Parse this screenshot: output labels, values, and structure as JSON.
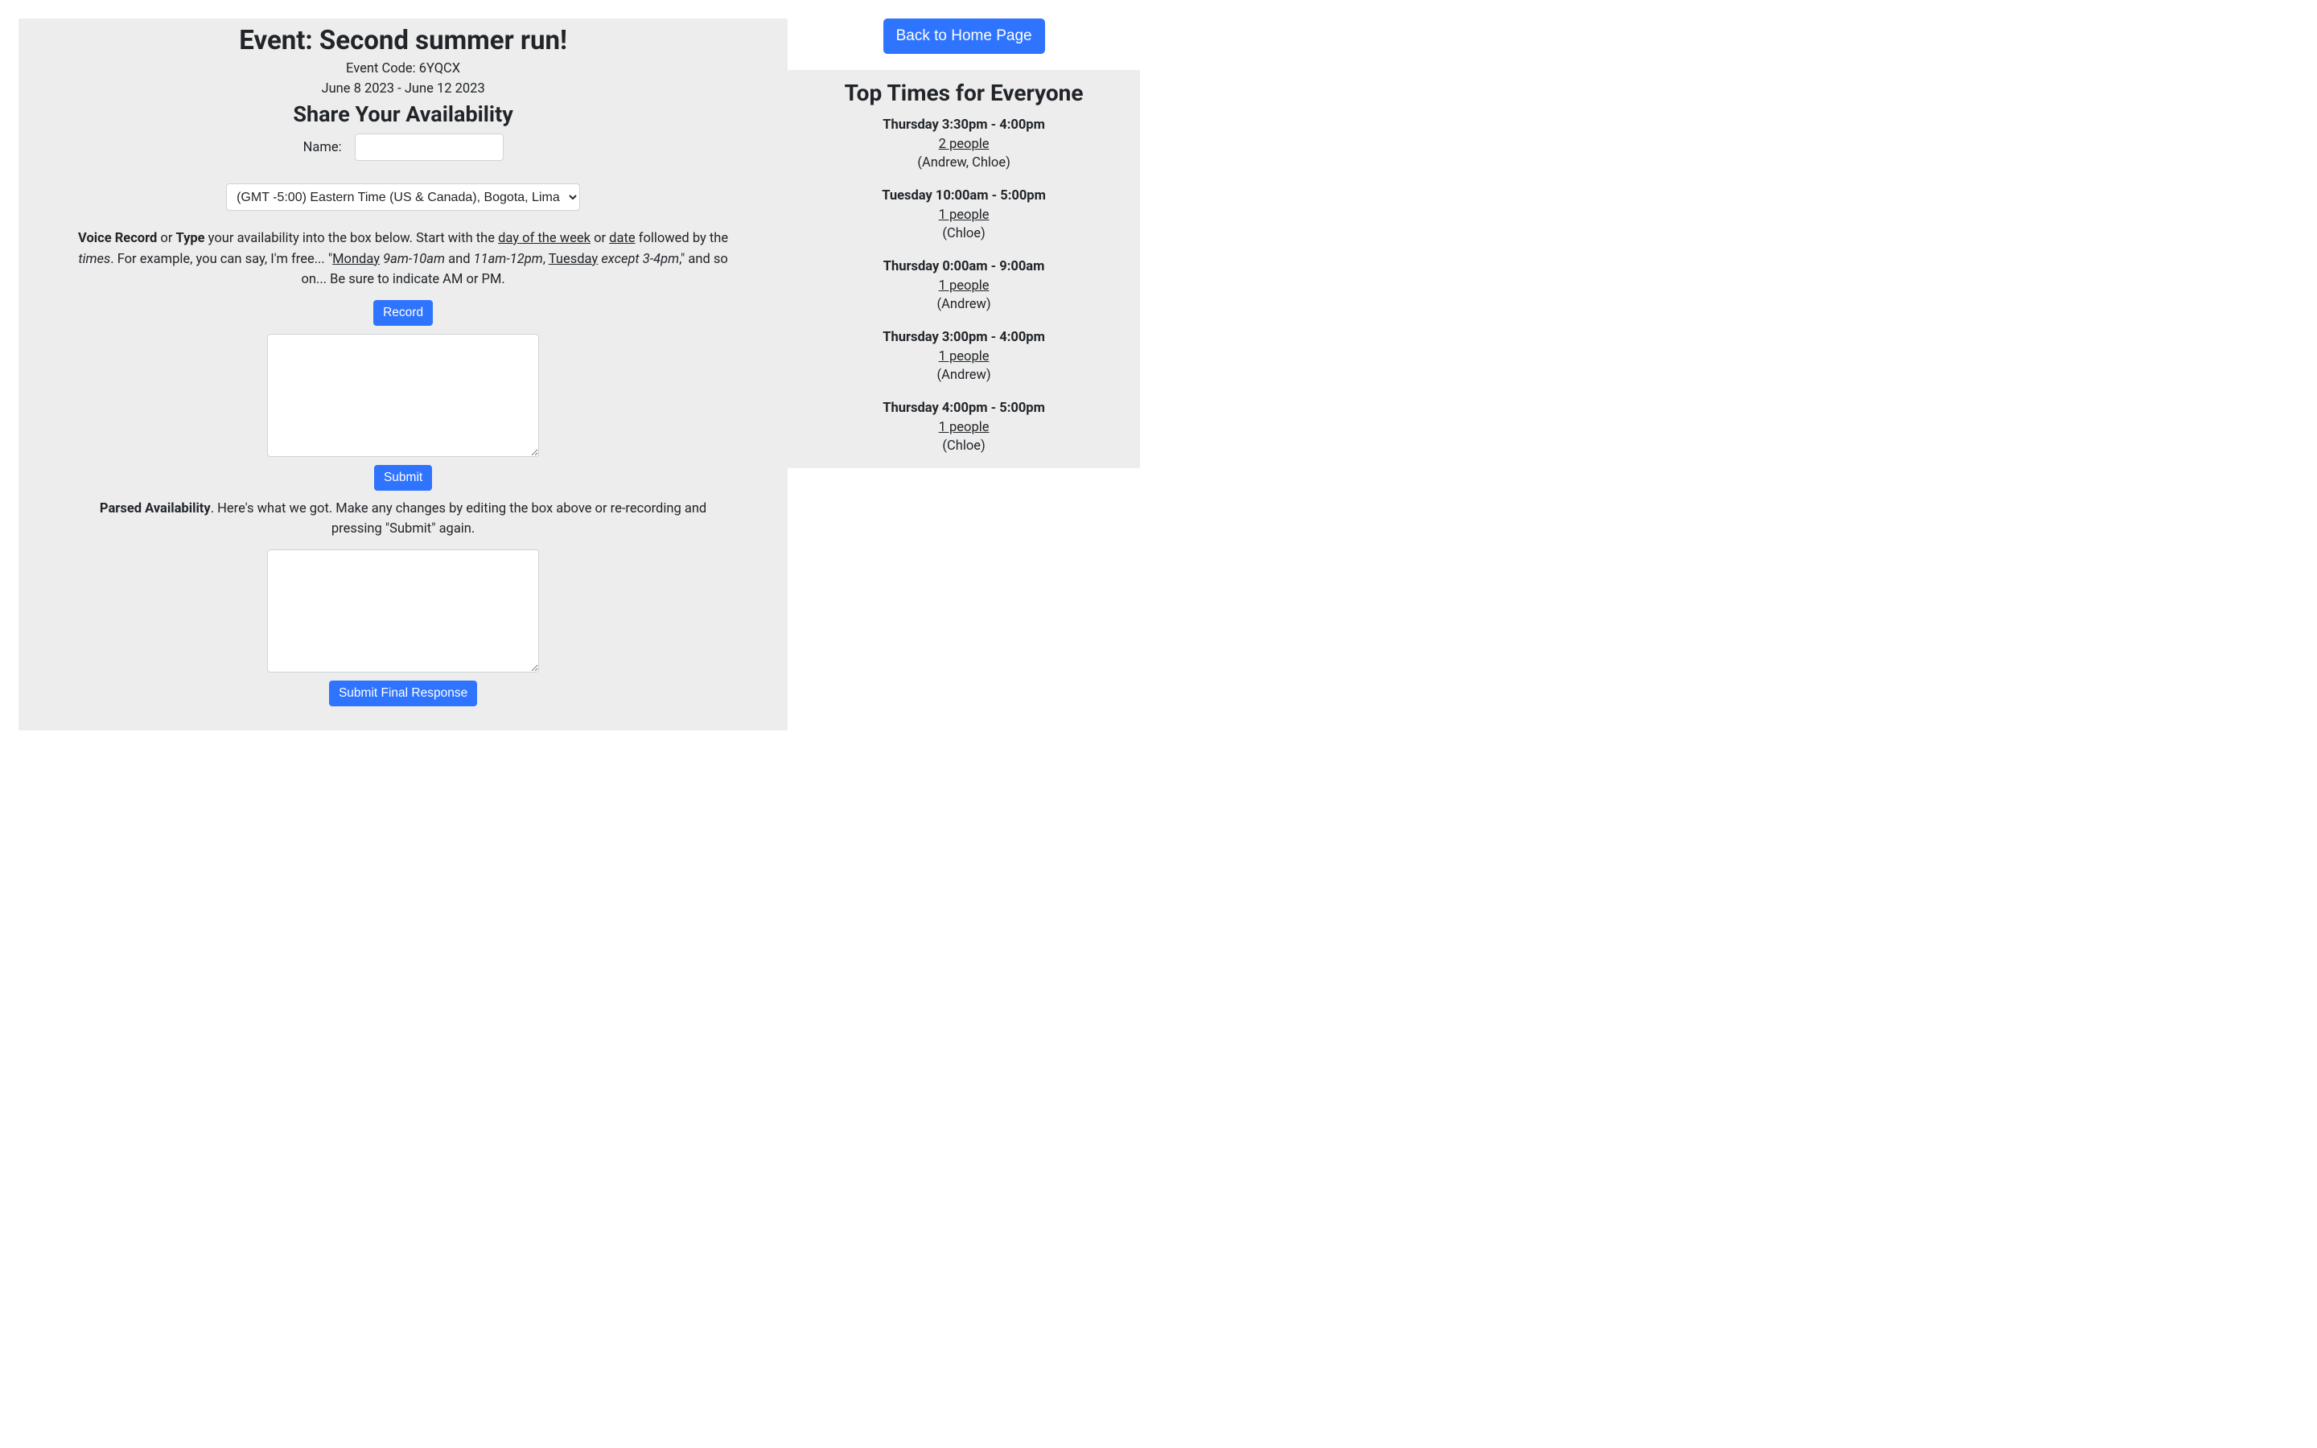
{
  "header": {
    "event_title": "Event: Second summer run!",
    "event_code": "Event Code: 6YQCX",
    "date_range": "June 8 2023 - June 12 2023",
    "share_heading": "Share Your Availability"
  },
  "name_row": {
    "label": "Name:",
    "value": ""
  },
  "timezone": {
    "selected": "(GMT -5:00) Eastern Time (US & Canada), Bogota, Lima"
  },
  "instructions": {
    "t1_b1": "Voice Record",
    "t1_plain1": " or ",
    "t1_b2": "Type",
    "t1_plain2": " your availability into the box below. Start with the ",
    "t1_u1": "day of the week",
    "t1_plain3": " or ",
    "t1_u2": "date",
    "t1_plain4": " followed by the ",
    "t1_i1": "times",
    "t1_plain5": ". For example, you can say, I'm free... \"",
    "t1_u3": "Monday",
    "t1_space1": " ",
    "t1_i2": "9am-10am",
    "t1_plain6": " and ",
    "t1_i3": "11am-12pm",
    "t1_plain7": ", ",
    "t1_u4": "Tuesday",
    "t1_space2": " ",
    "t1_i4": "except 3-4pm",
    "t1_plain8": ",\" and so on... Be sure to indicate AM or PM."
  },
  "buttons": {
    "record": "Record",
    "submit": "Submit",
    "submit_final": "Submit Final Response",
    "back_home": "Back to Home Page"
  },
  "parsed": {
    "b1": "Parsed Availability",
    "plain": ". Here's what we got. Make any changes by editing the box above or re-recording and pressing \"Submit\" again."
  },
  "textarea1": "",
  "textarea2": "",
  "top_times": {
    "title": "Top Times for Everyone",
    "slots": [
      {
        "time": "Thursday 3:30pm - 4:00pm",
        "count": "2 people",
        "names": "(Andrew, Chloe)"
      },
      {
        "time": "Tuesday 10:00am - 5:00pm",
        "count": "1 people",
        "names": "(Chloe)"
      },
      {
        "time": "Thursday 0:00am - 9:00am",
        "count": "1 people",
        "names": "(Andrew)"
      },
      {
        "time": "Thursday 3:00pm - 4:00pm",
        "count": "1 people",
        "names": "(Andrew)"
      },
      {
        "time": "Thursday 4:00pm - 5:00pm",
        "count": "1 people",
        "names": "(Chloe)"
      }
    ]
  }
}
